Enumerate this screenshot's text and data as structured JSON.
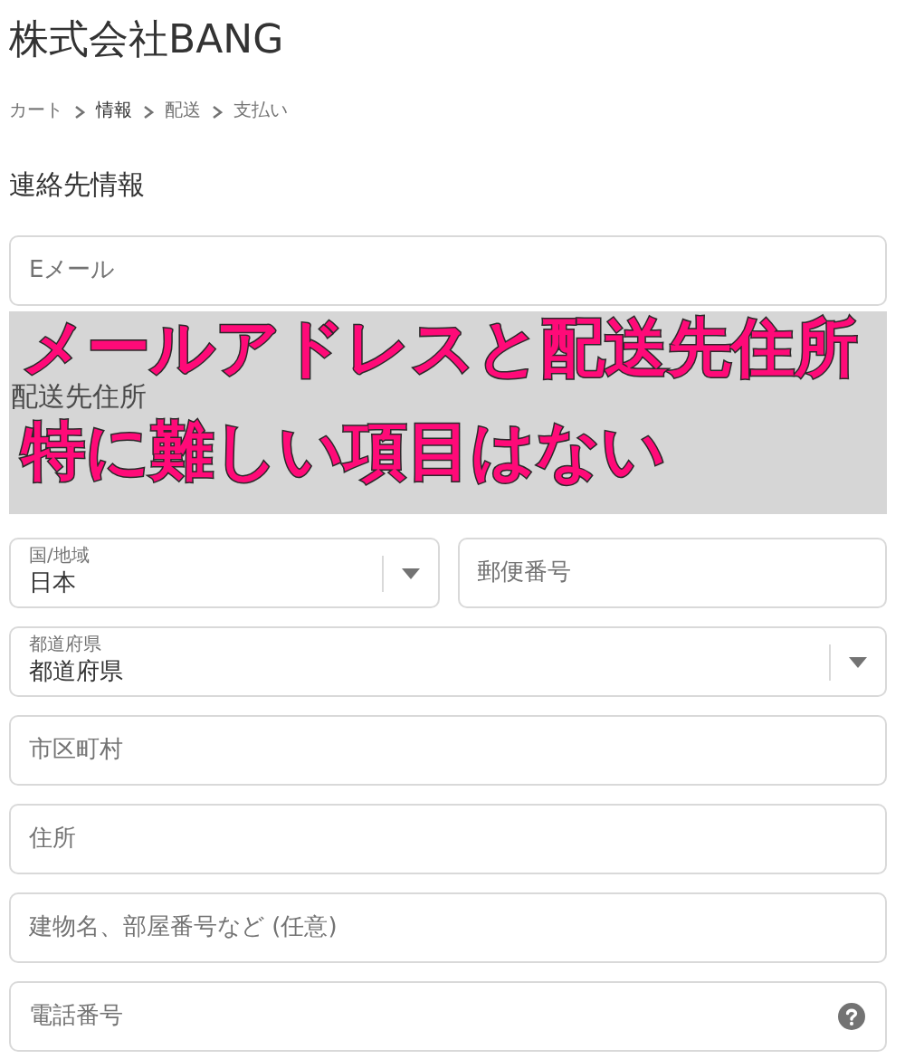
{
  "store_title": "株式会社BANG",
  "breadcrumb": [
    {
      "label": "カート",
      "selected": false
    },
    {
      "label": "情報",
      "selected": true
    },
    {
      "label": "配送",
      "selected": false
    },
    {
      "label": "支払い",
      "selected": false
    }
  ],
  "contact": {
    "heading": "連絡先情報",
    "email": {
      "placeholder": "Eメール"
    }
  },
  "shipping": {
    "heading": "配送先住所",
    "fields": [
      {
        "kind": "select",
        "label": "国/地域",
        "value": "日本",
        "half": true
      },
      {
        "kind": "input",
        "placeholder": "郵便番号",
        "half": true
      },
      {
        "kind": "select",
        "label": "都道府県",
        "value": "都道府県",
        "half": false
      },
      {
        "kind": "input",
        "placeholder": "市区町村",
        "half": false
      },
      {
        "kind": "input",
        "placeholder": "住所",
        "half": false
      },
      {
        "kind": "input",
        "placeholder": "建物名、部屋番号など (任意)",
        "half": false
      },
      {
        "kind": "input",
        "placeholder": "電話番号",
        "half": false,
        "help": true
      }
    ]
  },
  "caption": {
    "lines": [
      "メールアドレスと配送先住所",
      "特に難しい項目はない"
    ]
  }
}
